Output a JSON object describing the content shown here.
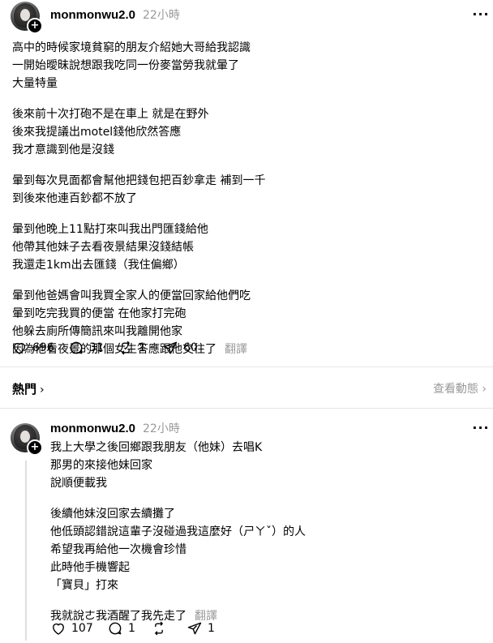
{
  "posts": [
    {
      "username": "monmonwu2.0",
      "timestamp": "22小時",
      "more_icon": "more-horizontal-icon",
      "paragraphs": [
        [
          "高中的時候家境貧窮的朋友介紹她大哥給我認識",
          "一開始曖昧說想跟我吃同一份麥當勞我就暈了",
          "大量特量"
        ],
        [
          "後來前十次打砲不是在車上 就是在野外",
          "後來我提議出motel錢他欣然答應",
          "我才意識到他是沒錢"
        ],
        [
          "暈到每次見面都會幫他把錢包把百鈔拿走 補到一千",
          "到後來他連百鈔都不放了"
        ],
        [
          "暈到他晚上11點打來叫我出門匯錢給他",
          "他帶其他妹子去看夜景結果沒錢結帳",
          "我還走1km出去匯錢（我住偏鄉）"
        ],
        [
          "暈到他爸媽會叫我買全家人的便當回家給他們吃",
          "暈到吃完我買的便當 在他家打完砲",
          "他躲去廁所傳簡訊來叫我離開他家",
          "因為他看夜景的那個女生答應跟他交往了"
        ]
      ],
      "translate_label": "翻譯",
      "likes": "696",
      "comments": "31",
      "reposts": "1",
      "shares": "60"
    },
    {
      "username": "monmonwu2.0",
      "timestamp": "22小時",
      "more_icon": "more-horizontal-icon",
      "paragraphs": [
        [
          "我上大學之後回鄉跟我朋友（他妹）去唱K",
          "那男的來接他妹回家",
          "說順便載我"
        ],
        [
          "後續他妹沒回家去續攤了",
          "他低頭認錯說這輩子沒碰過我這麼好（ㄕㄚˇ）的人",
          "希望我再給他一次機會珍惜",
          "此時他手機響起",
          "「寶貝」打來"
        ],
        [
          "我就說ㄜ我酒醒了我先走了"
        ]
      ],
      "translate_label": "翻譯",
      "likes": "107",
      "comments": "1",
      "reposts": "",
      "shares": "1"
    }
  ],
  "section": {
    "title": "熱門",
    "link": "查看動態"
  },
  "icons": {
    "like": "heart-icon",
    "comment": "comment-icon",
    "repost": "repost-icon",
    "share": "send-icon",
    "follow": "plus-icon",
    "chevron": "chevron-right-icon"
  }
}
